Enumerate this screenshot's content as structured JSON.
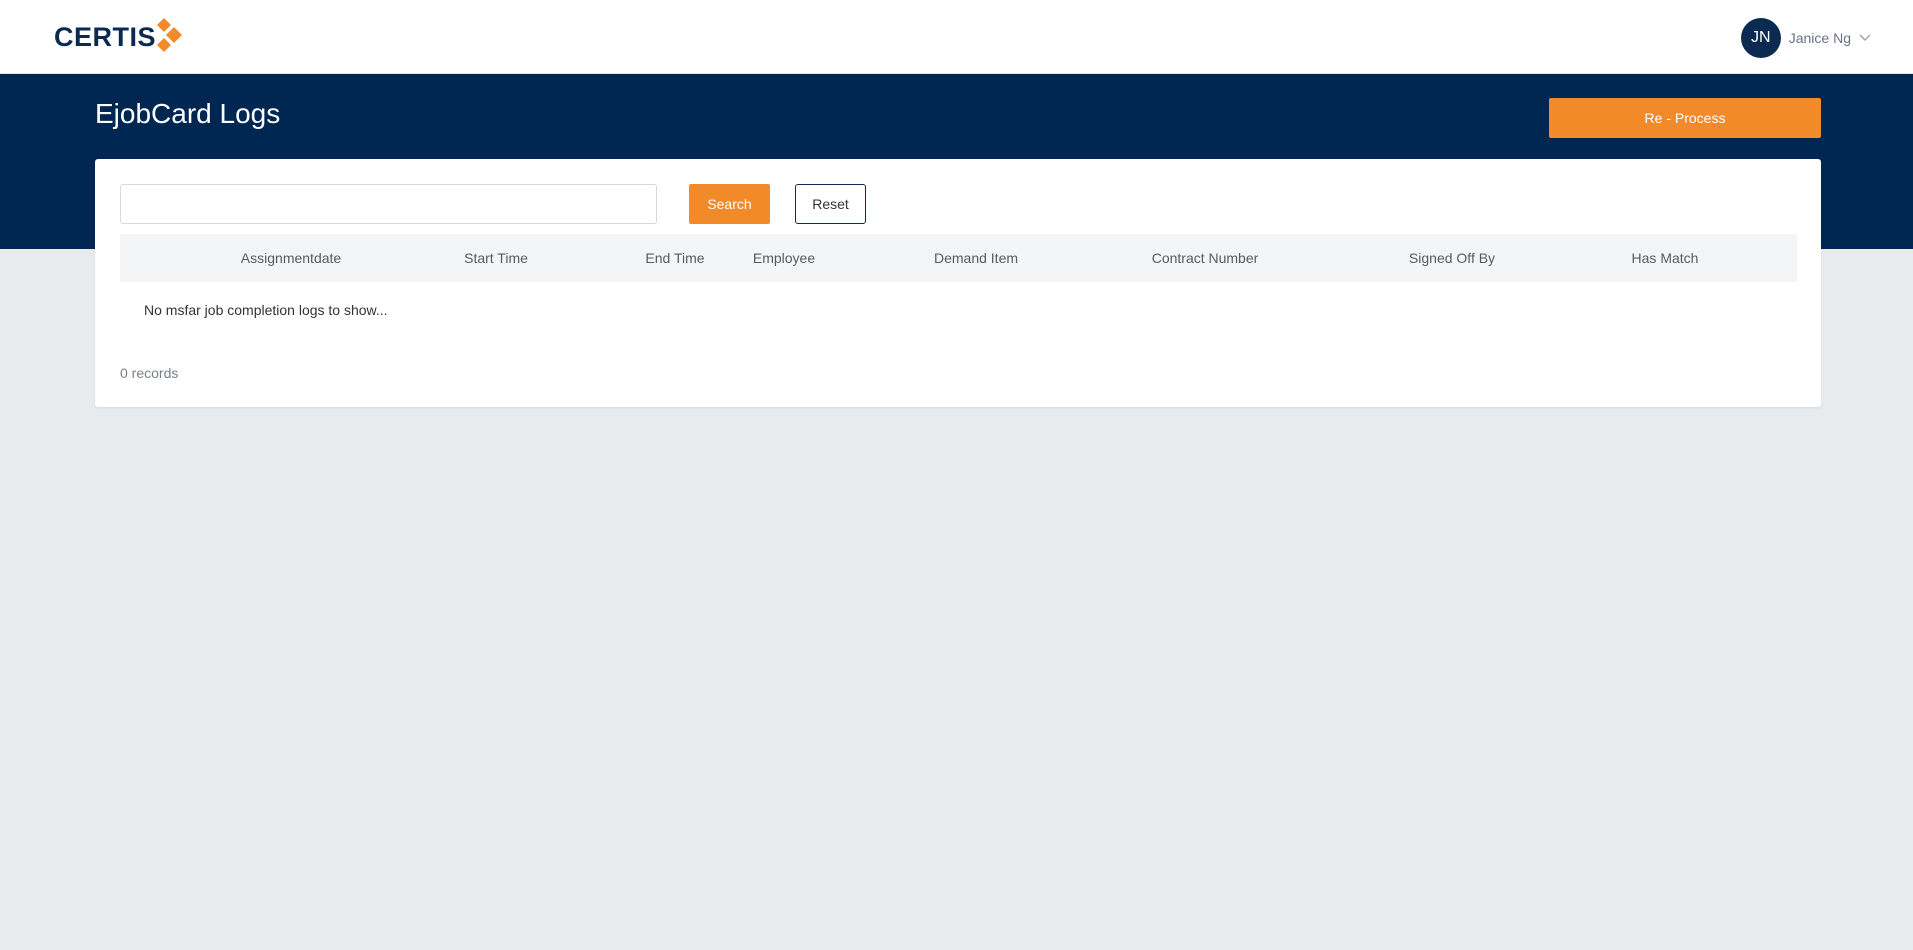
{
  "header": {
    "logo_text": "CERTIS",
    "logo_icon": "certis-diamond-logo-icon",
    "user": {
      "initials": "JN",
      "name": "Janice Ng",
      "menu_icon": "chevron-down-icon"
    }
  },
  "page": {
    "title": "EjobCard Logs",
    "reprocess_label": "Re - Process"
  },
  "search": {
    "value": "",
    "placeholder": "",
    "search_label": "Search",
    "reset_label": "Reset"
  },
  "table": {
    "columns": [
      "Assignmentdate",
      "Start Time",
      "End Time",
      "Employee",
      "Demand Item",
      "Contract Number",
      "Signed Off By",
      "Has Match"
    ],
    "rows": [],
    "empty_message": "No msfar job completion logs to show..."
  },
  "footer": {
    "records_text": "0 records"
  },
  "colors": {
    "brand_navy": "#002752",
    "accent_orange": "#f28a2a",
    "background": "#e8ebee"
  }
}
